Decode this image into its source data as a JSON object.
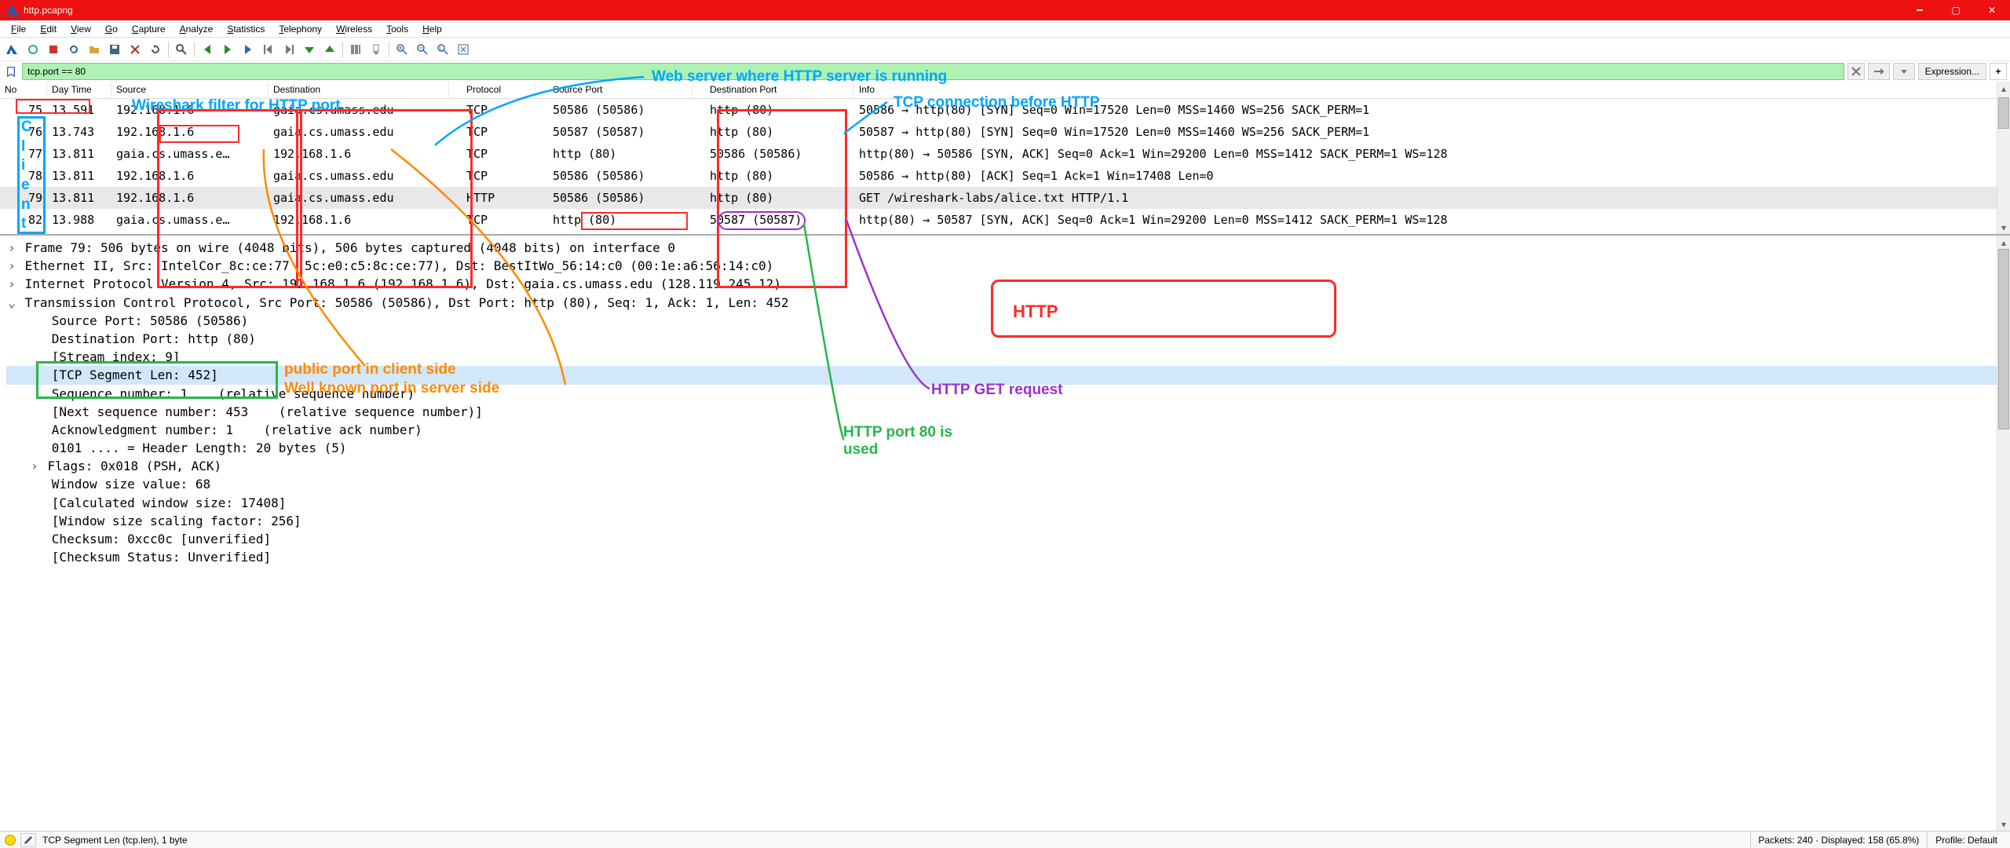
{
  "title": "http.pcapng",
  "menus": [
    "File",
    "Edit",
    "View",
    "Go",
    "Capture",
    "Analyze",
    "Statistics",
    "Telephony",
    "Wireless",
    "Tools",
    "Help"
  ],
  "filter": {
    "value": "tcp.port == 80",
    "expression_btn": "Expression...",
    "plus": "+"
  },
  "columns": {
    "no": "No",
    "daytime": "Day Time",
    "src": "Source",
    "dst": "Destination",
    "proto": "Protocol",
    "sport": "Source Port",
    "dport": "Destination Port",
    "info": "Info"
  },
  "rows": [
    {
      "no": "75",
      "dt": "13.591",
      "src": "192.168.1.6",
      "dst": "gaia.cs.umass.edu",
      "proto": "TCP",
      "sport": "50586 (50586)",
      "dport": "http (80)",
      "info": "50586 → http(80) [SYN] Seq=0 Win=17520 Len=0 MSS=1460 WS=256 SACK_PERM=1"
    },
    {
      "no": "76",
      "dt": "13.743",
      "src": "192.168.1.6",
      "dst": "gaia.cs.umass.edu",
      "proto": "TCP",
      "sport": "50587 (50587)",
      "dport": "http (80)",
      "info": "50587 → http(80) [SYN] Seq=0 Win=17520 Len=0 MSS=1460 WS=256 SACK_PERM=1"
    },
    {
      "no": "77",
      "dt": "13.811",
      "src": "gaia.cs.umass.e…",
      "dst": "192.168.1.6",
      "proto": "TCP",
      "sport": "http (80)",
      "dport": "50586 (50586)",
      "info": "http(80) → 50586 [SYN, ACK] Seq=0 Ack=1 Win=29200 Len=0 MSS=1412 SACK_PERM=1 WS=128"
    },
    {
      "no": "78",
      "dt": "13.811",
      "src": "192.168.1.6",
      "dst": "gaia.cs.umass.edu",
      "proto": "TCP",
      "sport": "50586 (50586)",
      "dport": "http (80)",
      "info": "50586 → http(80) [ACK] Seq=1 Ack=1 Win=17408 Len=0"
    },
    {
      "no": "79",
      "dt": "13.811",
      "src": "192.168.1.6",
      "dst": "gaia.cs.umass.edu",
      "proto": "HTTP",
      "sport": "50586 (50586)",
      "dport": "http (80)",
      "info": "GET /wireshark-labs/alice.txt HTTP/1.1",
      "sel": true
    },
    {
      "no": "82",
      "dt": "13.988",
      "src": "gaia.cs.umass.e…",
      "dst": "192.168.1.6",
      "proto": "TCP",
      "sport": "http (80)",
      "dport": "50587 (50587)",
      "info": "http(80) → 50587 [SYN, ACK] Seq=0 Ack=1 Win=29200 Len=0 MSS=1412 SACK_PERM=1 WS=128"
    }
  ],
  "tree": [
    {
      "exp": ">",
      "ind": 1,
      "t": "Frame 79: 506 bytes on wire (4048 bits), 506 bytes captured (4048 bits) on interface 0"
    },
    {
      "exp": ">",
      "ind": 1,
      "t": "Ethernet II, Src: IntelCor_8c:ce:77 (5c:e0:c5:8c:ce:77), Dst: BestItWo_56:14:c0 (00:1e:a6:56:14:c0)"
    },
    {
      "exp": ">",
      "ind": 1,
      "t": "Internet Protocol Version 4, Src: 192.168.1.6 (192.168.1.6), Dst: gaia.cs.umass.edu (128.119.245.12)"
    },
    {
      "exp": "v",
      "ind": 1,
      "t": "Transmission Control Protocol, Src Port: 50586 (50586), Dst Port: http (80), Seq: 1, Ack: 1, Len: 452"
    },
    {
      "ind": 2,
      "t": "Source Port: 50586 (50586)",
      "boxg": true
    },
    {
      "ind": 2,
      "t": "Destination Port: http (80)",
      "boxg": true
    },
    {
      "ind": 2,
      "t": "[Stream index: 9]"
    },
    {
      "ind": 2,
      "t": "[TCP Segment Len: 452]",
      "hl": true
    },
    {
      "ind": 2,
      "t": "Sequence number: 1    (relative sequence number)"
    },
    {
      "ind": 2,
      "t": "[Next sequence number: 453    (relative sequence number)]"
    },
    {
      "ind": 2,
      "t": "Acknowledgment number: 1    (relative ack number)"
    },
    {
      "ind": 2,
      "t": "0101 .... = Header Length: 20 bytes (5)"
    },
    {
      "exp": ">",
      "ind": 2,
      "t": "Flags: 0x018 (PSH, ACK)",
      "pexp": true
    },
    {
      "ind": 2,
      "t": "Window size value: 68"
    },
    {
      "ind": 2,
      "t": "[Calculated window size: 17408]"
    },
    {
      "ind": 2,
      "t": "[Window size scaling factor: 256]"
    },
    {
      "ind": 2,
      "t": "Checksum: 0xcc0c [unverified]"
    },
    {
      "ind": 2,
      "t": "[Checksum Status: Unverified]"
    }
  ],
  "status": {
    "left": "TCP Segment Len (tcp.len), 1 byte",
    "packets": "Packets: 240 · Displayed: 158 (65.8%)",
    "profile": "Profile: Default"
  },
  "annotations": {
    "webserver": "Web server where HTTP server is running",
    "filter": "Wireshark filter for HTTP port",
    "tcpbefore": "TCP connection before HTTP",
    "client": "Client",
    "http": "HTTP",
    "httpget": "HTTP GET request",
    "port80": "HTTP port 80 is used",
    "publicport": "public port in client side",
    "wellknown": "Well known port in server side"
  }
}
